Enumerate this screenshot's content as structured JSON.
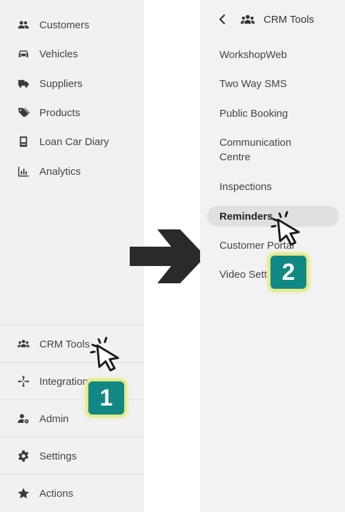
{
  "left_nav": {
    "items": [
      {
        "label": "Customers",
        "icon": "customers-icon"
      },
      {
        "label": "Vehicles",
        "icon": "car-icon"
      },
      {
        "label": "Suppliers",
        "icon": "truck-icon"
      },
      {
        "label": "Products",
        "icon": "tag-icon"
      },
      {
        "label": "Loan Car Diary",
        "icon": "diary-icon"
      },
      {
        "label": "Analytics",
        "icon": "bar-chart-icon"
      }
    ],
    "bottom_items": [
      {
        "label": "CRM Tools",
        "icon": "group-icon"
      },
      {
        "label": "Integrations",
        "icon": "move-arrows-icon"
      },
      {
        "label": "Admin",
        "icon": "user-gear-icon"
      },
      {
        "label": "Settings",
        "icon": "gear-icon"
      },
      {
        "label": "Actions",
        "icon": "star-icon"
      }
    ]
  },
  "crm_menu": {
    "title": "CRM Tools",
    "items": [
      {
        "label": "WorkshopWeb"
      },
      {
        "label": "Two Way SMS"
      },
      {
        "label": "Public Booking"
      },
      {
        "label": "Communication Centre"
      },
      {
        "label": "Inspections"
      },
      {
        "label": "Reminders",
        "active": true
      },
      {
        "label": "Customer Portal"
      },
      {
        "label": "Video Settings"
      }
    ]
  },
  "steps": [
    {
      "number": "1"
    },
    {
      "number": "2"
    }
  ],
  "colors": {
    "badge_bg": "#128884",
    "badge_border": "#e5ea8a",
    "panel_bg": "#f1f1f1",
    "active_bg": "#e0e0e0",
    "arrow": "#2a2a2a"
  }
}
